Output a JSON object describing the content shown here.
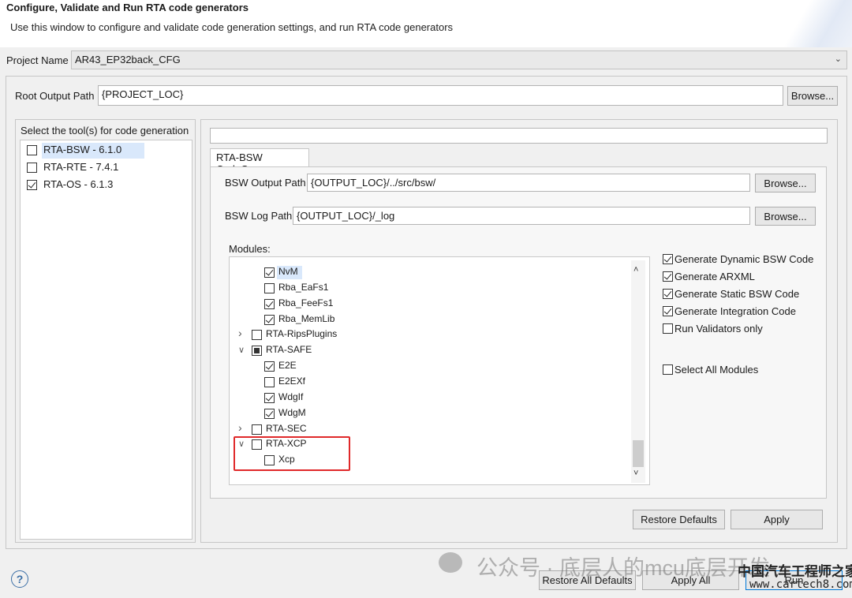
{
  "header": {
    "title": "Configure, Validate and Run RTA code generators",
    "description": "Use this window to configure and validate code generation settings, and run RTA code generators"
  },
  "project": {
    "label": "Project Name",
    "value": "AR43_EP32back_CFG"
  },
  "root_output": {
    "label": "Root Output Path",
    "value": "{PROJECT_LOC}",
    "browse_label": "Browse..."
  },
  "tools": {
    "heading": "Select the tool(s) for code generation",
    "items": [
      {
        "label": "RTA-BSW - 6.1.0",
        "checked": false,
        "selected": true
      },
      {
        "label": "RTA-RTE - 7.4.1",
        "checked": false,
        "selected": false
      },
      {
        "label": "RTA-OS - 6.1.3",
        "checked": true,
        "selected": false
      }
    ]
  },
  "tab": {
    "label": "RTA-BSW CodeGen"
  },
  "bsw_output": {
    "label": "BSW Output Path",
    "value": "{OUTPUT_LOC}/../src/bsw/",
    "browse_label": "Browse..."
  },
  "bsw_log": {
    "label": "BSW Log Path",
    "value": "{OUTPUT_LOC}/_log",
    "browse_label": "Browse..."
  },
  "modules": {
    "label": "Modules:",
    "items": [
      {
        "label": "NvM",
        "state": "checked",
        "level": 2,
        "expander": "",
        "highlight": true
      },
      {
        "label": "Rba_EaFs1",
        "state": "unchecked",
        "level": 2,
        "expander": ""
      },
      {
        "label": "Rba_FeeFs1",
        "state": "checked",
        "level": 2,
        "expander": ""
      },
      {
        "label": "Rba_MemLib",
        "state": "checked",
        "level": 2,
        "expander": ""
      },
      {
        "label": "RTA-RipsPlugins",
        "state": "unchecked",
        "level": 1,
        "expander": "collapsed"
      },
      {
        "label": "RTA-SAFE",
        "state": "partial",
        "level": 1,
        "expander": "expanded"
      },
      {
        "label": "E2E",
        "state": "checked",
        "level": 2,
        "expander": ""
      },
      {
        "label": "E2EXf",
        "state": "unchecked",
        "level": 2,
        "expander": ""
      },
      {
        "label": "WdgIf",
        "state": "checked",
        "level": 2,
        "expander": ""
      },
      {
        "label": "WdgM",
        "state": "checked",
        "level": 2,
        "expander": ""
      },
      {
        "label": "RTA-SEC",
        "state": "unchecked",
        "level": 1,
        "expander": "collapsed"
      },
      {
        "label": "RTA-XCP",
        "state": "unchecked",
        "level": 1,
        "expander": "expanded"
      },
      {
        "label": "Xcp",
        "state": "unchecked",
        "level": 2,
        "expander": ""
      }
    ]
  },
  "options": {
    "items": [
      {
        "label": "Generate Dynamic BSW Code",
        "checked": true
      },
      {
        "label": "Generate ARXML",
        "checked": true
      },
      {
        "label": "Generate Static BSW Code",
        "checked": true
      },
      {
        "label": "Generate Integration Code",
        "checked": true
      },
      {
        "label": "Run Validators only",
        "checked": false
      }
    ],
    "select_all_label": "Select All Modules",
    "select_all_checked": false
  },
  "buttons": {
    "restore_defaults": "Restore Defaults",
    "apply": "Apply",
    "restore_all_defaults": "Restore All Defaults",
    "apply_all": "Apply All",
    "run": "Run"
  },
  "watermark": {
    "text": "公众号 · 底层人的mcu底层开发",
    "site_name": "中国汽车工程师之家",
    "site_url": "www.cartech8.com"
  },
  "colors": {
    "highlight_box": "#e0292a",
    "selection": "#d9e8fb"
  }
}
